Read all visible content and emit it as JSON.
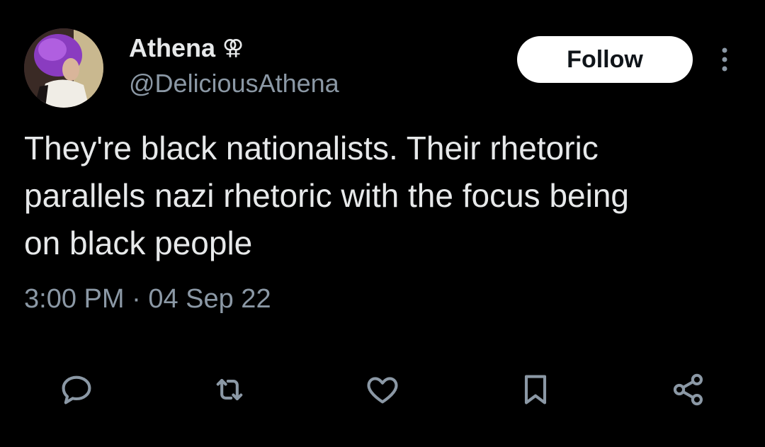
{
  "author": {
    "display_name": "Athena",
    "name_symbol": "⚢",
    "handle": "@DeliciousAthena"
  },
  "follow_label": "Follow",
  "tweet": {
    "lines": [
      "They're black nationalists. Their rhetoric",
      "parallels nazi rhetoric with the focus being",
      "on black people"
    ]
  },
  "meta": {
    "time": "3:00 PM",
    "separator": "·",
    "date": "04 Sep 22"
  },
  "actions": [
    "reply-icon",
    "retweet-icon",
    "like-icon",
    "bookmark-icon",
    "share-icon"
  ],
  "colors": {
    "background": "#000000",
    "text": "#e7e9ea",
    "secondary": "#8b98a5",
    "button_bg": "#ffffff"
  }
}
